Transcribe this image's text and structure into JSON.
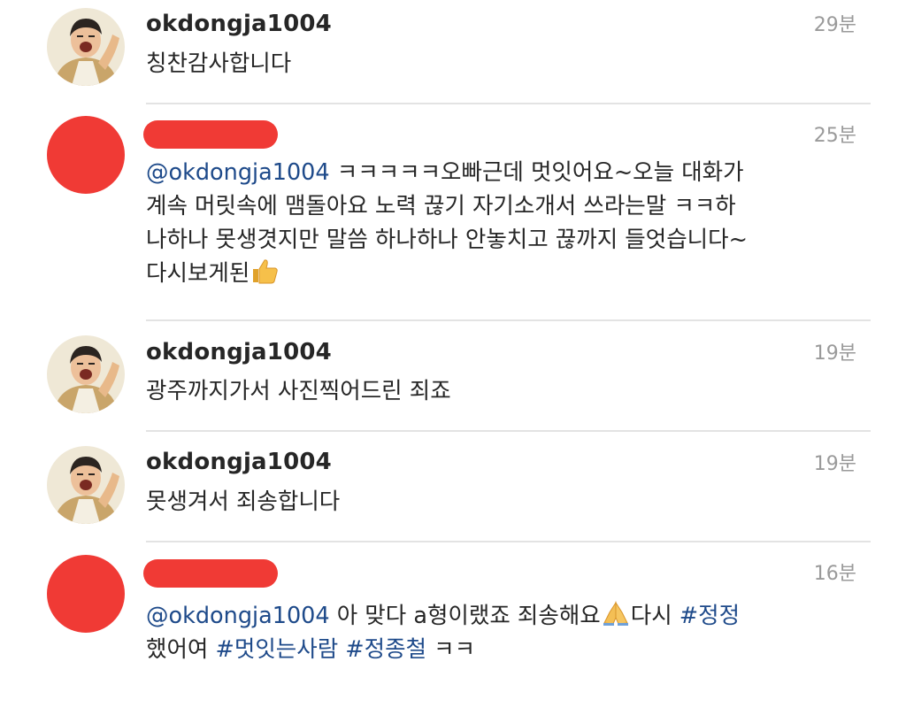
{
  "comments": [
    {
      "username": "okdongja1004",
      "time": "29분",
      "lines": [
        [
          {
            "t": "칭찬감사합니다"
          }
        ]
      ]
    },
    {
      "username": "",
      "time": "25분",
      "lines": [
        [
          {
            "t": "@okdongja1004",
            "k": "mention"
          },
          {
            "t": " ㅋㅋㅋㅋㅋ오빠근데 멋잇어요~오늘 대화가"
          }
        ],
        [
          {
            "t": "계속 머릿속에 맴돌아요 노력 끊기 자기소개서 쓰라는말 ㅋㅋ하"
          }
        ],
        [
          {
            "t": "나하나 못생겻지만 말씀 하나하나 안놓치고 끊까지 들엇습니다~"
          }
        ],
        [
          {
            "t": "다시보게된"
          },
          {
            "emoji": "thumbs-up"
          }
        ]
      ]
    },
    {
      "username": "okdongja1004",
      "time": "19분",
      "lines": [
        [
          {
            "t": "광주까지가서 사진찍어드린 죄죠"
          }
        ]
      ]
    },
    {
      "username": "okdongja1004",
      "time": "19분",
      "lines": [
        [
          {
            "t": "못생겨서 죄송합니다"
          }
        ]
      ]
    },
    {
      "username": "",
      "time": "16분",
      "lines": [
        [
          {
            "t": "@okdongja1004",
            "k": "mention"
          },
          {
            "t": " 아 맞다 a형이랬죠 죄송해요"
          },
          {
            "emoji": "folded-hands"
          },
          {
            "t": "다시 "
          },
          {
            "t": "#정정",
            "k": "hashtag"
          }
        ],
        [
          {
            "t": "했어여 "
          },
          {
            "t": "#멋잇는사람",
            "k": "hashtag"
          },
          {
            "t": " "
          },
          {
            "t": "#정종철",
            "k": "hashtag"
          },
          {
            "t": " ㅋㅋ"
          }
        ]
      ]
    }
  ],
  "colors": {
    "link": "#1e4a8a",
    "redaction": "#f03a35",
    "timestamp": "#9a9a9a"
  }
}
